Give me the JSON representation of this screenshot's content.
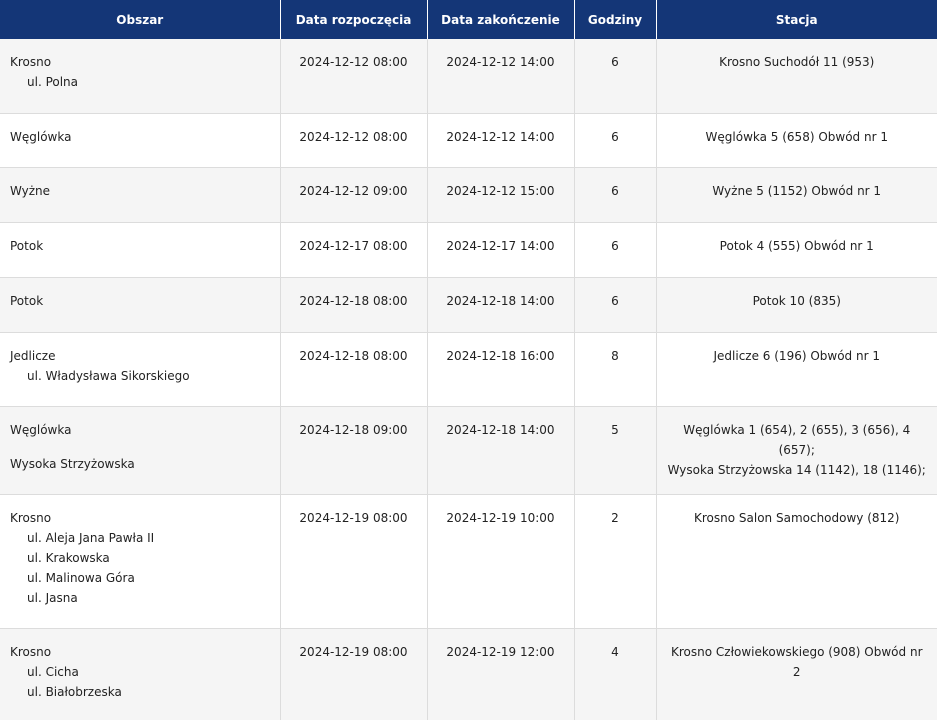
{
  "table": {
    "headers": [
      "Obszar",
      "Data rozpoczęcia",
      "Data zakończenie",
      "Godziny",
      "Stacja"
    ],
    "rows": [
      {
        "areas": [
          {
            "name": "Krosno",
            "streets": [
              "ul. Polna"
            ]
          }
        ],
        "start": "2024-12-12 08:00",
        "end": "2024-12-12 14:00",
        "hours": "6",
        "station": [
          "Krosno Suchodół 11 (953)"
        ]
      },
      {
        "areas": [
          {
            "name": "Węglówka",
            "streets": []
          }
        ],
        "start": "2024-12-12 08:00",
        "end": "2024-12-12 14:00",
        "hours": "6",
        "station": [
          "Węglówka 5 (658) Obwód nr 1"
        ]
      },
      {
        "areas": [
          {
            "name": "Wyżne",
            "streets": []
          }
        ],
        "start": "2024-12-12 09:00",
        "end": "2024-12-12 15:00",
        "hours": "6",
        "station": [
          "Wyżne 5 (1152) Obwód nr 1"
        ]
      },
      {
        "areas": [
          {
            "name": "Potok",
            "streets": []
          }
        ],
        "start": "2024-12-17 08:00",
        "end": "2024-12-17 14:00",
        "hours": "6",
        "station": [
          "Potok 4 (555) Obwód nr 1"
        ]
      },
      {
        "areas": [
          {
            "name": "Potok",
            "streets": []
          }
        ],
        "start": "2024-12-18 08:00",
        "end": "2024-12-18 14:00",
        "hours": "6",
        "station": [
          "Potok 10 (835)"
        ]
      },
      {
        "areas": [
          {
            "name": "Jedlicze",
            "streets": [
              "ul. Władysława Sikorskiego"
            ]
          }
        ],
        "start": "2024-12-18 08:00",
        "end": "2024-12-18 16:00",
        "hours": "8",
        "station": [
          "Jedlicze 6 (196) Obwód nr 1"
        ]
      },
      {
        "areas": [
          {
            "name": "Węglówka",
            "streets": []
          },
          {
            "name": "Wysoka Strzyżowska",
            "streets": []
          }
        ],
        "start": "2024-12-18 09:00",
        "end": "2024-12-18 14:00",
        "hours": "5",
        "station": [
          "Węglówka 1 (654), 2 (655), 3 (656), 4 (657);",
          "Wysoka Strzyżowska 14 (1142), 18 (1146);"
        ]
      },
      {
        "areas": [
          {
            "name": "Krosno",
            "streets": [
              "ul. Aleja Jana Pawła II",
              "ul. Krakowska",
              "ul. Malinowa Góra",
              "ul. Jasna"
            ]
          }
        ],
        "start": "2024-12-19 08:00",
        "end": "2024-12-19 10:00",
        "hours": "2",
        "station": [
          "Krosno Salon Samochodowy (812)"
        ]
      },
      {
        "areas": [
          {
            "name": "Krosno",
            "streets": [
              "ul. Cicha",
              "ul. Białobrzeska"
            ]
          }
        ],
        "start": "2024-12-19 08:00",
        "end": "2024-12-19 12:00",
        "hours": "4",
        "station": [
          "Krosno Człowiekowskiego (908) Obwód nr 2"
        ]
      }
    ]
  }
}
